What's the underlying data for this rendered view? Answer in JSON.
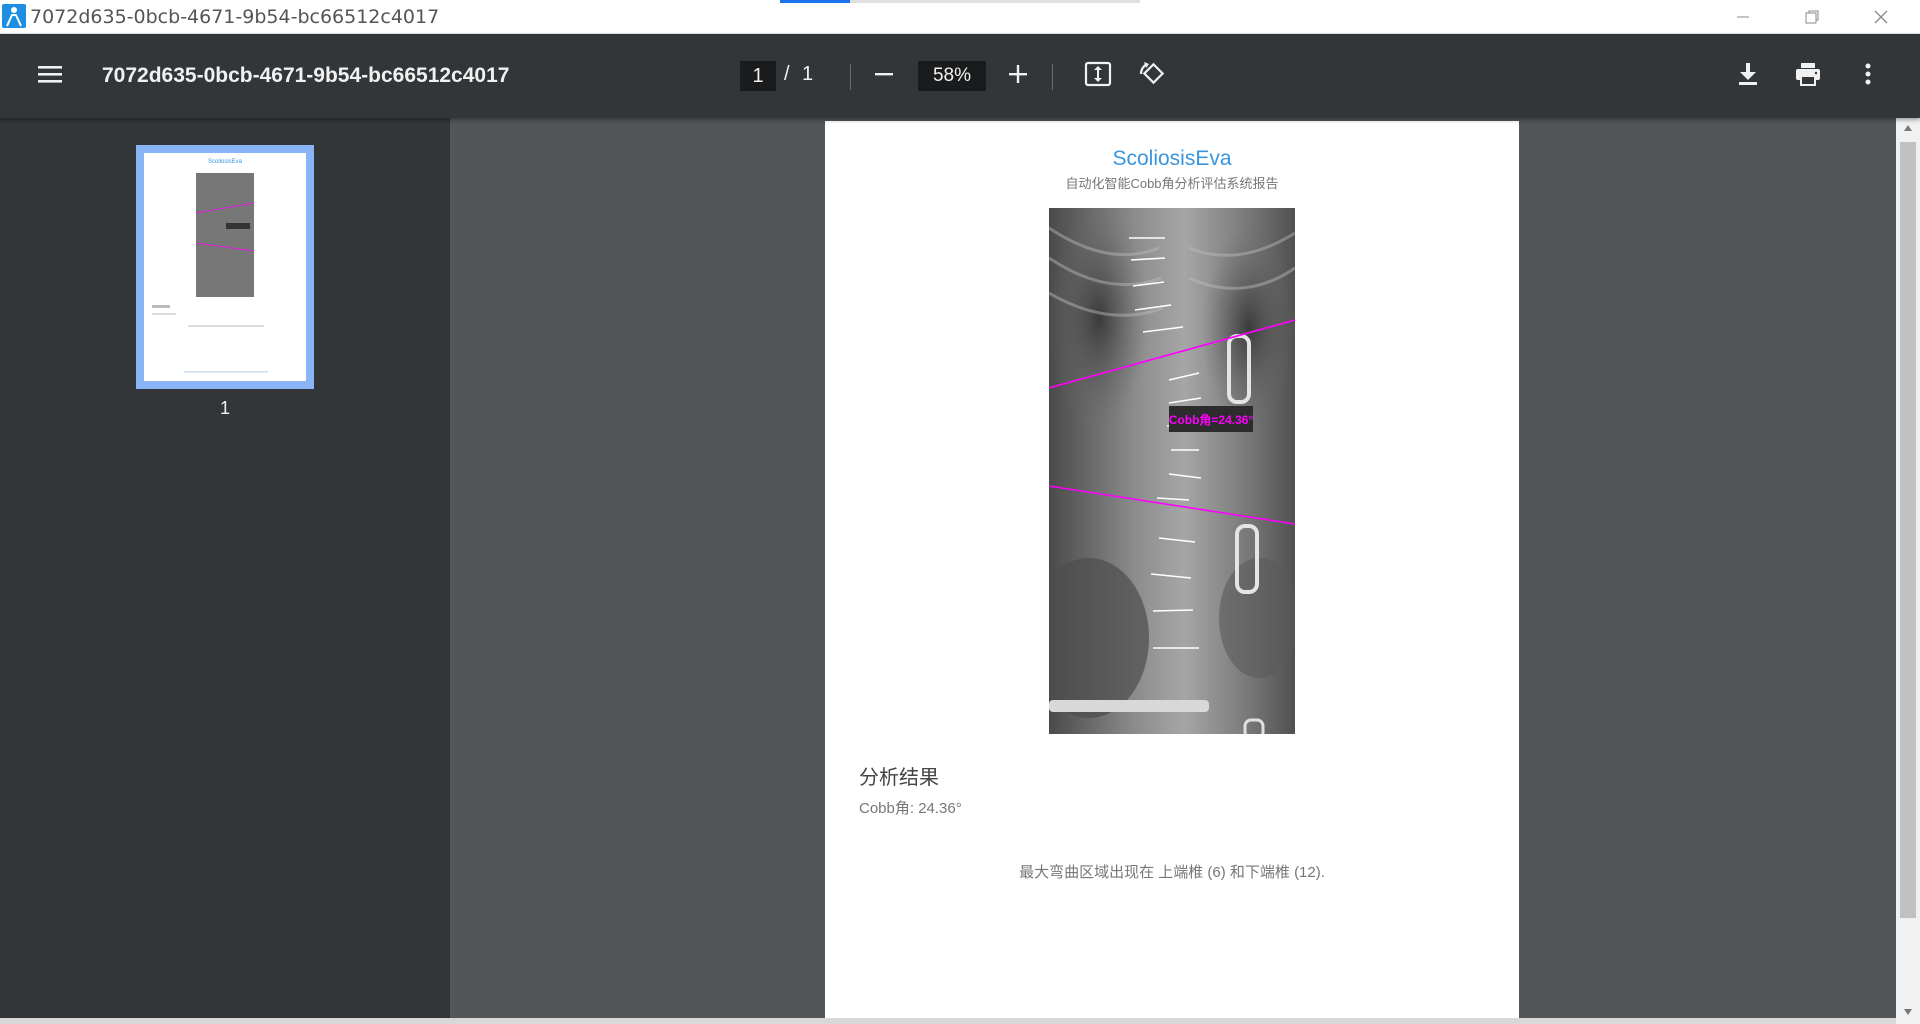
{
  "window": {
    "title": "7072d635-0bcb-4671-9b54-bc66512c4017"
  },
  "toolbar": {
    "doc_title": "7072d635-0bcb-4671-9b54-bc66512c4017",
    "current_page": "1",
    "page_separator": "/",
    "total_pages": "1",
    "zoom": "58%",
    "icons": [
      "menu-icon",
      "zoom-out-icon",
      "zoom-in-icon",
      "fit-page-icon",
      "rotate-icon",
      "download-icon",
      "print-icon",
      "more-vert-icon"
    ]
  },
  "sidebar": {
    "thumbnails": [
      {
        "label": "1"
      }
    ]
  },
  "report": {
    "brand": "ScoliosisEva",
    "subtitle": "自动化智能Cobb角分析评估系统报告",
    "cobb_label": "Cobb角=24.36°",
    "section_title": "分析结果",
    "cobb_result": "Cobb角: 24.36°",
    "summary": "最大弯曲区域出现在 上端椎 (6) 和下端椎 (12)."
  },
  "colors": {
    "toolbar_bg": "#323639",
    "viewport_bg": "#525659",
    "brand_blue": "#3a95dd",
    "annotation_magenta": "#ff00ff",
    "thumb_selected": "#8ab4f8"
  }
}
